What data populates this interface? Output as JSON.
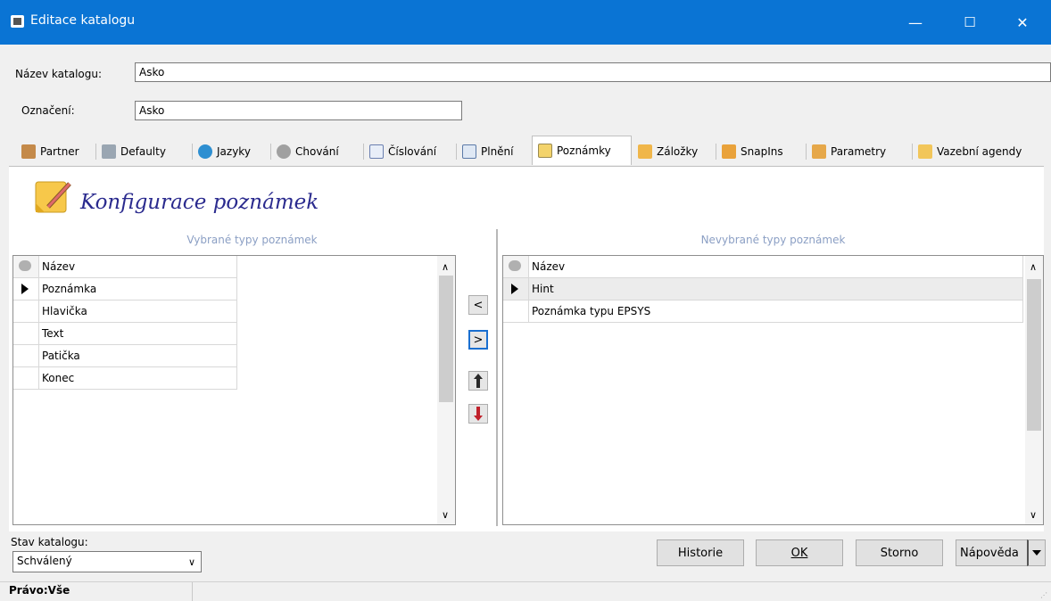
{
  "window": {
    "title": "Editace katalogu",
    "minimize": "—",
    "maximize": "☐",
    "close": "✕"
  },
  "form": {
    "name_label": "Název katalogu:",
    "name_value": "Asko",
    "code_label": "Označení:",
    "code_value": "Asko"
  },
  "tabs": [
    "Partner",
    "Defaulty",
    "Jazyky",
    "Chování",
    "Číslování",
    "Plnění",
    "Poznámky",
    "Záložky",
    "SnapIns",
    "Parametry",
    "Vazební agendy"
  ],
  "active_tab": "Poznámky",
  "section": {
    "title": "Konfigurace poznámek"
  },
  "selected_list": {
    "title": "Vybrané typy poznámek",
    "column": "Název",
    "rows": [
      "Poznámka",
      "Hlavička",
      "Text",
      "Patička",
      "Konec"
    ]
  },
  "unselected_list": {
    "title": "Nevybrané typy poznámek",
    "column": "Název",
    "rows": [
      "Hint",
      "Poznámka typu EPSYS"
    ]
  },
  "transfer": {
    "left": "<",
    "right": ">"
  },
  "footer": {
    "state_label": "Stav katalogu:",
    "state_value": "Schválený",
    "history": "Historie",
    "ok": "OK",
    "cancel": "Storno",
    "help": "Nápověda"
  },
  "statusbar": {
    "rights": "Právo:Vše"
  },
  "colors": {
    "titlebar": "#0a74d4",
    "accent_blue": "#2a2a8e",
    "arrow_red": "#c0202a"
  }
}
